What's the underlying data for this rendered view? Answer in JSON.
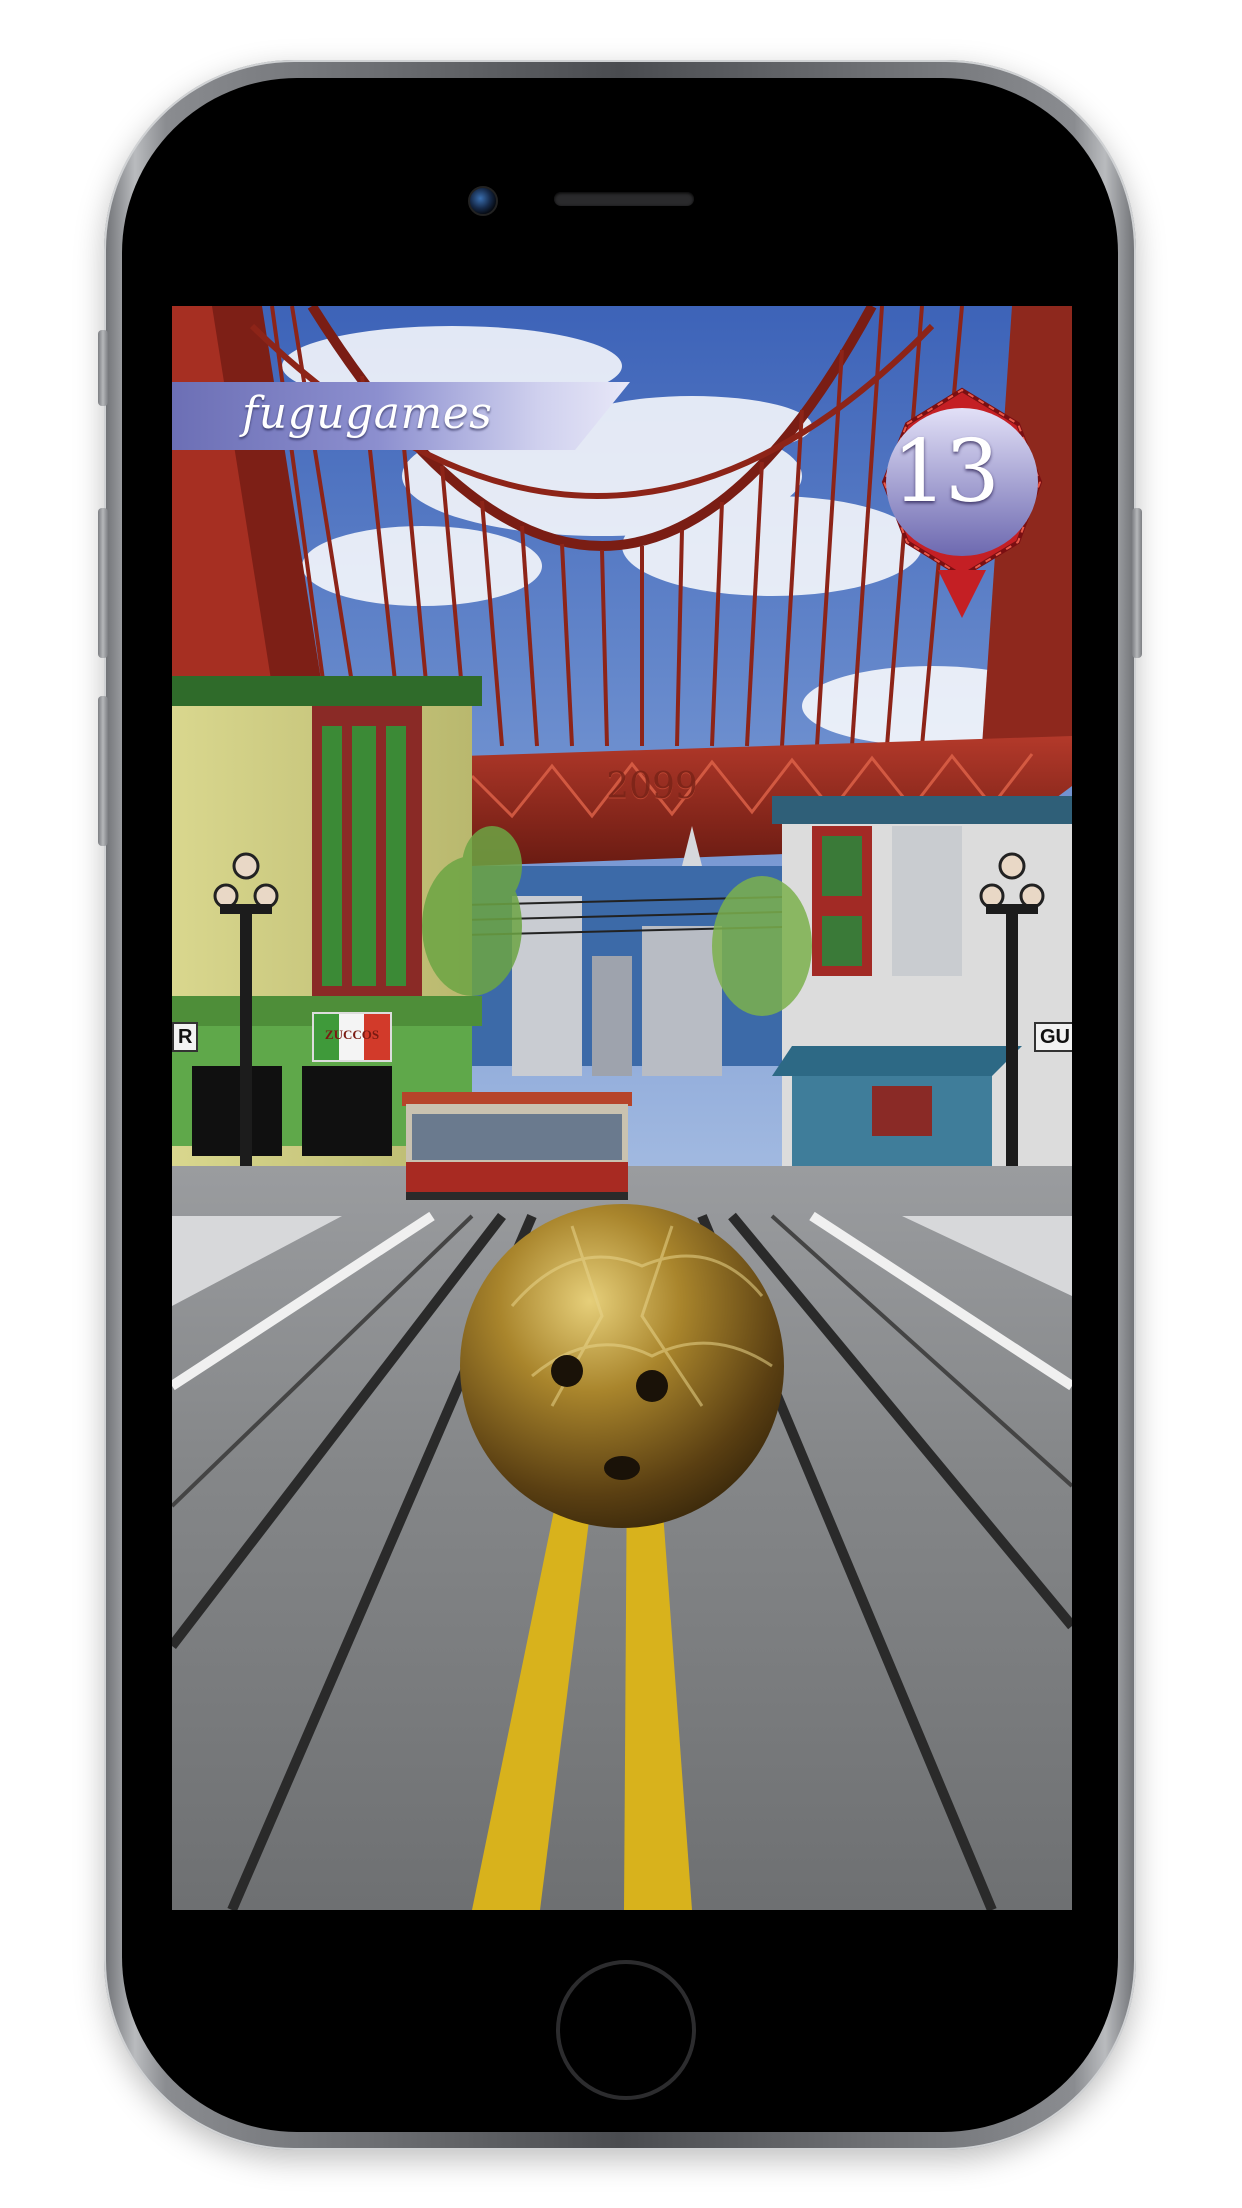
{
  "hud": {
    "player_name": "fugugames",
    "score": "13"
  },
  "scene": {
    "bridge_year": "2099",
    "shop_sign_left": "R",
    "shop_sign_right": "GU",
    "storefront_sign": "ZUCCOS"
  },
  "colors": {
    "banner": "#8c8fcf",
    "badge_ring": "#c41f24",
    "badge_center": "#b9b7e8",
    "bridge": "#9a2a1e",
    "road": "#8a8c90",
    "center_line": "#d8b21c",
    "ball": "#9b7a2a"
  }
}
